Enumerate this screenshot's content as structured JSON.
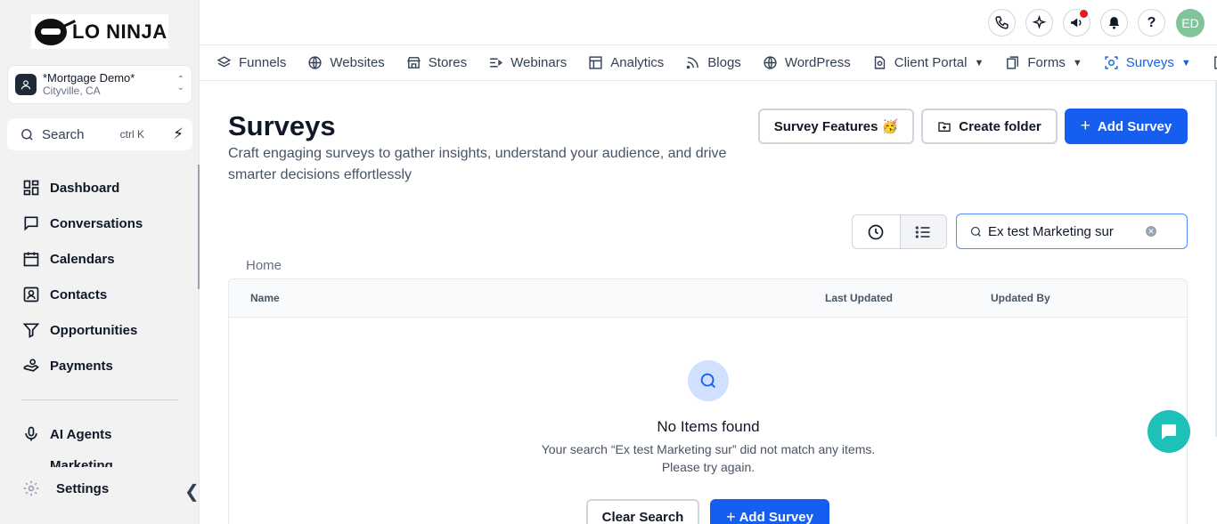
{
  "app": {
    "logo_text": "LO NINJA",
    "account_name": "*Mortgage Demo*",
    "account_location": "Cityville, CA"
  },
  "sidebar": {
    "search_label": "Search",
    "search_shortcut": "ctrl K",
    "items": [
      {
        "label": "Dashboard",
        "icon": "dashboard-icon"
      },
      {
        "label": "Conversations",
        "icon": "chat-icon"
      },
      {
        "label": "Calendars",
        "icon": "calendar-icon"
      },
      {
        "label": "Contacts",
        "icon": "contact-icon"
      },
      {
        "label": "Opportunities",
        "icon": "filter-icon"
      },
      {
        "label": "Payments",
        "icon": "payments-icon"
      }
    ],
    "ai_agents": "AI Agents",
    "partial_item": "Marketing",
    "settings": "Settings"
  },
  "topbar": {
    "avatar_initials": "ED",
    "help_label": "?"
  },
  "tabs": [
    {
      "label": "Funnels",
      "icon": "layers-icon",
      "dropdown": false
    },
    {
      "label": "Websites",
      "icon": "globe-icon",
      "dropdown": false
    },
    {
      "label": "Stores",
      "icon": "store-icon",
      "dropdown": false
    },
    {
      "label": "Webinars",
      "icon": "webinar-icon",
      "dropdown": false
    },
    {
      "label": "Analytics",
      "icon": "analytics-icon",
      "dropdown": false
    },
    {
      "label": "Blogs",
      "icon": "rss-icon",
      "dropdown": false
    },
    {
      "label": "WordPress",
      "icon": "globe-icon",
      "dropdown": false
    },
    {
      "label": "Client Portal",
      "icon": "portal-icon",
      "dropdown": true
    },
    {
      "label": "Forms",
      "icon": "forms-icon",
      "dropdown": true
    },
    {
      "label": "Surveys",
      "icon": "survey-icon",
      "dropdown": true,
      "active": true
    }
  ],
  "page": {
    "title": "Surveys",
    "description": "Craft engaging surveys to gather insights, understand your audience, and drive smarter decisions effortlessly",
    "survey_features_label": "Survey Features 🥳",
    "create_folder_label": "Create folder",
    "add_survey_label": "Add Survey",
    "search_value": "Ex test Marketing sur",
    "breadcrumb": "Home"
  },
  "table": {
    "columns": [
      "Name",
      "Last Updated",
      "Updated By"
    ]
  },
  "empty_state": {
    "title": "No Items found",
    "message": "Your search “Ex test Marketing sur” did not match any items. Please try again.",
    "clear_search_label": "Clear Search",
    "add_survey_label": "Add Survey"
  },
  "colors": {
    "accent": "#155eef",
    "chat": "#1ec1b8",
    "avatar": "#7fc49a",
    "notification_dot": "#e11d1d"
  }
}
